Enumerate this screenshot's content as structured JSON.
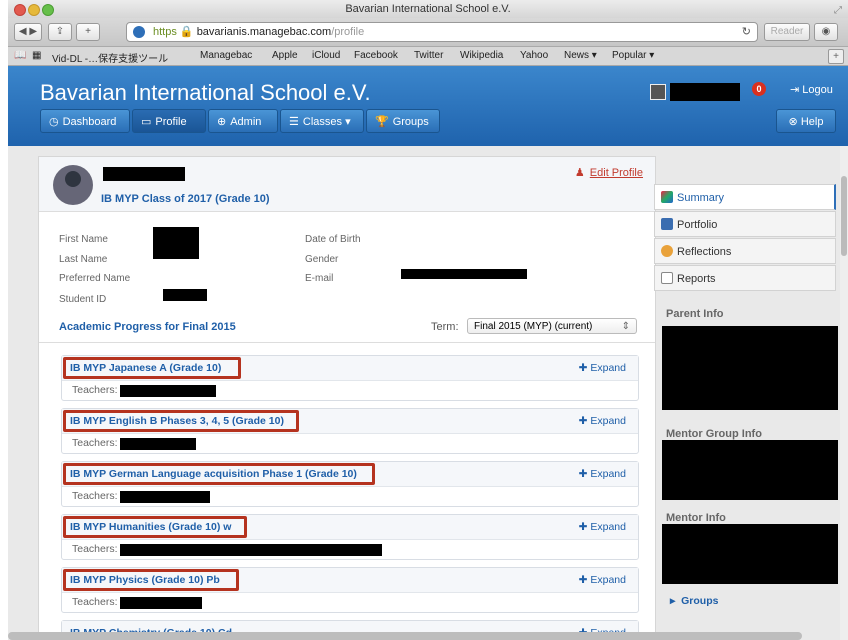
{
  "browser": {
    "title": "Bavarian International School e.V.",
    "url_scheme": "https",
    "url_host": "bavarianis.managebac.com",
    "url_path": "/profile",
    "reader_label": "Reader",
    "reload_icon": "reload-icon",
    "bookmarks": [
      "Vid-DL -…保存支援ツール",
      "Managebac",
      "Apple",
      "iCloud",
      "Facebook",
      "Twitter",
      "Wikipedia",
      "Yahoo",
      "News ▾",
      "Popular ▾"
    ]
  },
  "site": {
    "title": "Bavarian International School e.V.",
    "nav": [
      {
        "label": "Dashboard",
        "icon": "clock-icon"
      },
      {
        "label": "Profile",
        "icon": "id-card-icon"
      },
      {
        "label": "Admin",
        "icon": "globe-icon"
      },
      {
        "label": "Classes",
        "icon": "list-icon"
      },
      {
        "label": "Groups",
        "icon": "trophy-icon"
      }
    ],
    "notifications": "0",
    "logout_label": "Logou",
    "help_label": "Help"
  },
  "profile": {
    "class_line": "IB MYP Class of 2017 (Grade 10)",
    "edit_label": "Edit Profile",
    "fields_left": [
      "First Name",
      "Last Name",
      "Preferred Name",
      "Student ID"
    ],
    "fields_right": [
      "Date of Birth",
      "Gender",
      "E-mail"
    ]
  },
  "academic": {
    "heading": "Academic Progress for Final 2015",
    "term_label": "Term:",
    "term_value": "Final 2015 (MYP) (current)",
    "expand_label": "Expand",
    "teachers_label": "Teachers:",
    "courses": [
      "IB MYP Japanese A (Grade 10)",
      "IB MYP English B Phases 3, 4, 5 (Grade 10)",
      "IB MYP German Language acquisition Phase 1 (Grade 10)",
      "IB MYP Humanities (Grade 10) w",
      "IB MYP Physics (Grade 10) Pb",
      "IB MYP Chemistry (Grade 10) Cd"
    ]
  },
  "sidebar": {
    "tabs": [
      "Summary",
      "Portfolio",
      "Reflections",
      "Reports"
    ],
    "parent_info": "Parent Info",
    "mentor_group_info": "Mentor Group Info",
    "mentor_info": "Mentor Info",
    "groups_label": "Groups"
  },
  "colors": {
    "accent": "#1f5fa8",
    "header": "#2a72bd",
    "highlight_box": "#b5331f"
  }
}
